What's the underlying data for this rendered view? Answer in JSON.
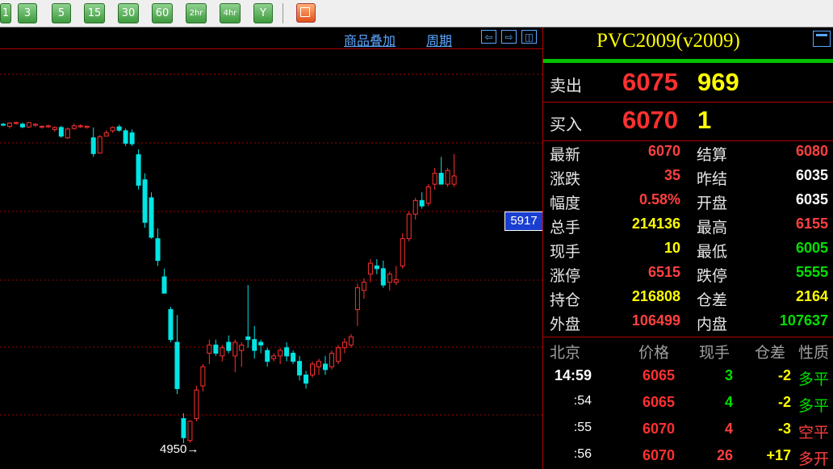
{
  "toolbar": {
    "buttons": [
      "1",
      "3",
      "5",
      "15",
      "30",
      "60",
      "2hr",
      "4hr",
      "Y"
    ]
  },
  "chart_header": {
    "overlay_label": "商品叠加",
    "period_label": "周期"
  },
  "chart": {
    "current_price_tag": "5917",
    "low_label": "4950→"
  },
  "quote": {
    "title": "PVC2009(v2009)",
    "sell_label": "卖出",
    "sell_price": "6075",
    "sell_volume": "969",
    "buy_label": "买入",
    "buy_price": "6070",
    "buy_volume": "1",
    "stats_left": [
      {
        "label": "最新",
        "value": "6070",
        "color": "#ff4040"
      },
      {
        "label": "涨跌",
        "value": "35",
        "color": "#ff4040"
      },
      {
        "label": "幅度",
        "value": "0.58%",
        "color": "#ff4040"
      },
      {
        "label": "总手",
        "value": "214136",
        "color": "#ffff00"
      },
      {
        "label": "现手",
        "value": "10",
        "color": "#ffff00"
      },
      {
        "label": "涨停",
        "value": "6515",
        "color": "#ff4040"
      },
      {
        "label": "持仓",
        "value": "216808",
        "color": "#ffff00"
      },
      {
        "label": "外盘",
        "value": "106499",
        "color": "#ff4040"
      }
    ],
    "stats_right": [
      {
        "label": "结算",
        "value": "6080",
        "color": "#ff4040"
      },
      {
        "label": "昨结",
        "value": "6035",
        "color": "#ffffff"
      },
      {
        "label": "开盘",
        "value": "6035",
        "color": "#ffffff"
      },
      {
        "label": "最高",
        "value": "6155",
        "color": "#ff4040"
      },
      {
        "label": "最低",
        "value": "6005",
        "color": "#00e000"
      },
      {
        "label": "跌停",
        "value": "5555",
        "color": "#00e000"
      },
      {
        "label": "仓差",
        "value": "2164",
        "color": "#ffff00"
      },
      {
        "label": "内盘",
        "value": "107637",
        "color": "#00e000"
      }
    ],
    "ticks_header": [
      "北京",
      "价格",
      "现手",
      "仓差",
      "性质"
    ],
    "ticks": [
      {
        "time": "14:59",
        "price": "6065",
        "vol": "3",
        "vol_color": "#00e000",
        "oi": "-2",
        "nature": "多平",
        "nature_color": "#00e000"
      },
      {
        "time": ":54",
        "price": "6065",
        "vol": "4",
        "vol_color": "#00e000",
        "oi": "-2",
        "nature": "多平",
        "nature_color": "#00e000"
      },
      {
        "time": ":55",
        "price": "6070",
        "vol": "4",
        "vol_color": "#ff4040",
        "oi": "-3",
        "nature": "空平",
        "nature_color": "#ff4040"
      },
      {
        "time": ":56",
        "price": "6070",
        "vol": "26",
        "vol_color": "#ff4040",
        "oi": "+17",
        "nature": "多开",
        "nature_color": "#ff4040"
      }
    ]
  },
  "chart_data": {
    "type": "candlestick",
    "ohlc": [
      {
        "o": 6120,
        "h": 6124,
        "l": 6112,
        "c": 6118
      },
      {
        "o": 6112,
        "h": 6128,
        "l": 6104,
        "c": 6124
      },
      {
        "o": 6124,
        "h": 6130,
        "l": 6118,
        "c": 6126
      },
      {
        "o": 6120,
        "h": 6126,
        "l": 6105,
        "c": 6110
      },
      {
        "o": 6110,
        "h": 6128,
        "l": 6106,
        "c": 6126
      },
      {
        "o": 6116,
        "h": 6124,
        "l": 6110,
        "c": 6120
      },
      {
        "o": 6110,
        "h": 6116,
        "l": 6104,
        "c": 6112
      },
      {
        "o": 6112,
        "h": 6118,
        "l": 6106,
        "c": 6114
      },
      {
        "o": 6100,
        "h": 6112,
        "l": 6092,
        "c": 6108
      },
      {
        "o": 6108,
        "h": 6114,
        "l": 6070,
        "c": 6076
      },
      {
        "o": 6070,
        "h": 6108,
        "l": 6066,
        "c": 6102
      },
      {
        "o": 6104,
        "h": 6122,
        "l": 6100,
        "c": 6114
      },
      {
        "o": 6112,
        "h": 6120,
        "l": 6106,
        "c": 6114
      },
      {
        "o": 6108,
        "h": 6115,
        "l": 6104,
        "c": 6112
      },
      {
        "o": 6070,
        "h": 6108,
        "l": 6000,
        "c": 6012
      },
      {
        "o": 6014,
        "h": 6080,
        "l": 6012,
        "c": 6074
      },
      {
        "o": 6076,
        "h": 6098,
        "l": 6078,
        "c": 6088
      },
      {
        "o": 6096,
        "h": 6112,
        "l": 6088,
        "c": 6108
      },
      {
        "o": 6110,
        "h": 6118,
        "l": 6092,
        "c": 6098
      },
      {
        "o": 6096,
        "h": 6104,
        "l": 6040,
        "c": 6050
      },
      {
        "o": 6088,
        "h": 6100,
        "l": 6040,
        "c": 6048
      },
      {
        "o": 6008,
        "h": 6028,
        "l": 5880,
        "c": 5896
      },
      {
        "o": 5916,
        "h": 5940,
        "l": 5740,
        "c": 5760
      },
      {
        "o": 5850,
        "h": 5870,
        "l": 5700,
        "c": 5705
      },
      {
        "o": 5700,
        "h": 5738,
        "l": 5600,
        "c": 5620
      },
      {
        "o": 5560,
        "h": 5590,
        "l": 5500,
        "c": 5500
      },
      {
        "o": 5440,
        "h": 5450,
        "l": 5320,
        "c": 5330
      },
      {
        "o": 5320,
        "h": 5420,
        "l": 5130,
        "c": 5150
      },
      {
        "o": 5040,
        "h": 5060,
        "l": 4950,
        "c": 4970
      },
      {
        "o": 4960,
        "h": 5035,
        "l": 4951,
        "c": 5030
      },
      {
        "o": 5040,
        "h": 5160,
        "l": 5030,
        "c": 5145
      },
      {
        "o": 5160,
        "h": 5240,
        "l": 5140,
        "c": 5230
      },
      {
        "o": 5280,
        "h": 5330,
        "l": 5240,
        "c": 5310
      },
      {
        "o": 5310,
        "h": 5330,
        "l": 5270,
        "c": 5280
      },
      {
        "o": 5270,
        "h": 5310,
        "l": 5250,
        "c": 5300
      },
      {
        "o": 5320,
        "h": 5345,
        "l": 5280,
        "c": 5290
      },
      {
        "o": 5270,
        "h": 5330,
        "l": 5210,
        "c": 5320
      },
      {
        "o": 5290,
        "h": 5320,
        "l": 5230,
        "c": 5310
      },
      {
        "o": 5340,
        "h": 5530,
        "l": 5300,
        "c": 5330
      },
      {
        "o": 5330,
        "h": 5380,
        "l": 5260,
        "c": 5290
      },
      {
        "o": 5320,
        "h": 5330,
        "l": 5280,
        "c": 5310
      },
      {
        "o": 5290,
        "h": 5300,
        "l": 5230,
        "c": 5250
      },
      {
        "o": 5260,
        "h": 5280,
        "l": 5250,
        "c": 5270
      },
      {
        "o": 5270,
        "h": 5300,
        "l": 5240,
        "c": 5290
      },
      {
        "o": 5300,
        "h": 5320,
        "l": 5250,
        "c": 5270
      },
      {
        "o": 5280,
        "h": 5290,
        "l": 5240,
        "c": 5250
      },
      {
        "o": 5250,
        "h": 5270,
        "l": 5180,
        "c": 5200
      },
      {
        "o": 5200,
        "h": 5215,
        "l": 5150,
        "c": 5170
      },
      {
        "o": 5200,
        "h": 5250,
        "l": 5190,
        "c": 5240
      },
      {
        "o": 5230,
        "h": 5260,
        "l": 5200,
        "c": 5250
      },
      {
        "o": 5240,
        "h": 5270,
        "l": 5200,
        "c": 5220
      },
      {
        "o": 5230,
        "h": 5290,
        "l": 5220,
        "c": 5280
      },
      {
        "o": 5250,
        "h": 5310,
        "l": 5240,
        "c": 5300
      },
      {
        "o": 5300,
        "h": 5335,
        "l": 5280,
        "c": 5320
      },
      {
        "o": 5310,
        "h": 5350,
        "l": 5300,
        "c": 5340
      },
      {
        "o": 5440,
        "h": 5535,
        "l": 5380,
        "c": 5520
      },
      {
        "o": 5510,
        "h": 5555,
        "l": 5480,
        "c": 5540
      },
      {
        "o": 5570,
        "h": 5625,
        "l": 5540,
        "c": 5610
      },
      {
        "o": 5600,
        "h": 5625,
        "l": 5570,
        "c": 5590
      },
      {
        "o": 5590,
        "h": 5620,
        "l": 5520,
        "c": 5530
      },
      {
        "o": 5540,
        "h": 5580,
        "l": 5510,
        "c": 5570
      },
      {
        "o": 5540,
        "h": 5600,
        "l": 5530,
        "c": 5550
      },
      {
        "o": 5600,
        "h": 5720,
        "l": 5590,
        "c": 5700
      },
      {
        "o": 5700,
        "h": 5800,
        "l": 5690,
        "c": 5790
      },
      {
        "o": 5790,
        "h": 5850,
        "l": 5770,
        "c": 5840
      },
      {
        "o": 5840,
        "h": 5870,
        "l": 5810,
        "c": 5820
      },
      {
        "o": 5830,
        "h": 5900,
        "l": 5820,
        "c": 5890
      },
      {
        "o": 5900,
        "h": 5960,
        "l": 5880,
        "c": 5940
      },
      {
        "o": 5940,
        "h": 6000,
        "l": 5920,
        "c": 5900
      },
      {
        "o": 5900,
        "h": 5960,
        "l": 5890,
        "c": 5950
      },
      {
        "o": 5900,
        "h": 6010,
        "l": 5890,
        "c": 5930
      }
    ],
    "y_range": [
      4950,
      6155
    ],
    "grid": true
  }
}
